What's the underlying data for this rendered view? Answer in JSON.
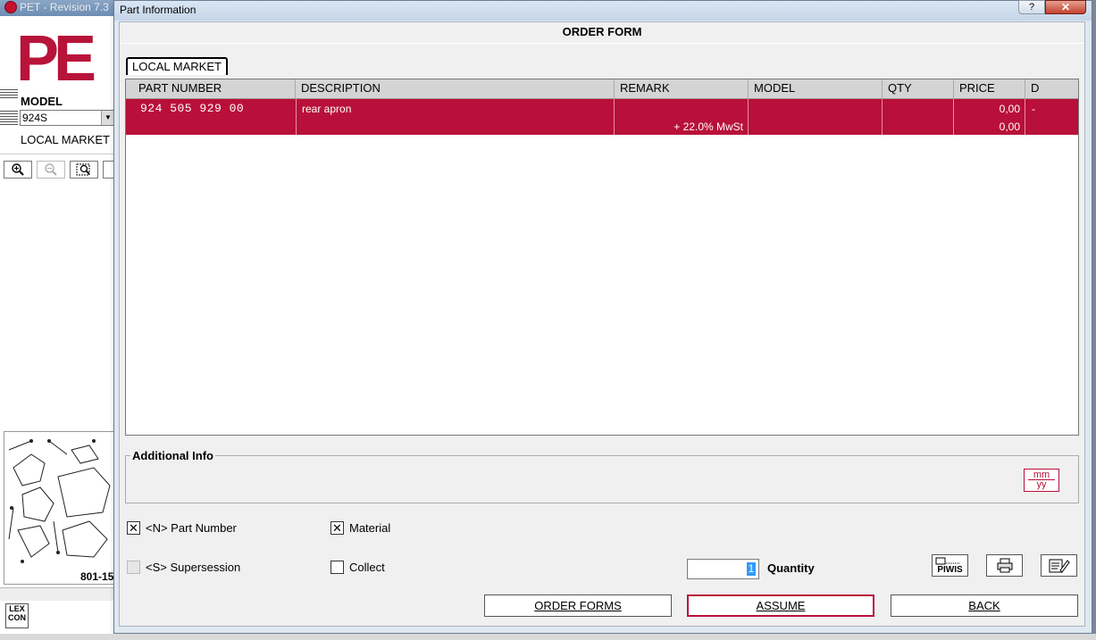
{
  "background_app": {
    "title": "PET - Revision 7.3",
    "logo": "PE",
    "model_label": "MODEL",
    "model_value": "924S",
    "local_market": "LOCAL MARKET",
    "drawing_label": "801-15",
    "lex_icon": "LEX CON"
  },
  "dialog": {
    "title": "Part Information",
    "help_label": "?",
    "close_label": "✕",
    "form_title": "ORDER FORM",
    "tab_label": "LOCAL MARKET",
    "columns": [
      "PART NUMBER",
      "DESCRIPTION",
      "REMARK",
      "MODEL",
      "QTY",
      "PRICE",
      "D"
    ],
    "rows": [
      {
        "part_number": "924 505 929 00",
        "description": "rear apron",
        "remark": "+ 22.0% MwSt",
        "model": "",
        "qty": "",
        "price_1": "0,00",
        "price_2": "0,00",
        "d": "-"
      }
    ],
    "additional_info_label": "Additional Info",
    "mmyy": {
      "top": "mm",
      "bottom": "yy"
    },
    "checkboxes": {
      "part_number": {
        "label": "<N> Part Number",
        "checked": true
      },
      "material": {
        "label": "Material",
        "checked": true
      },
      "supersession": {
        "label": "<S> Supersession",
        "checked": false
      },
      "collect": {
        "label": "Collect",
        "checked": false
      }
    },
    "quantity": {
      "value": "1",
      "label": "Quantity"
    },
    "piwis_label": "PIWIS",
    "buttons": {
      "order_forms": "ORDER FORMS",
      "assume": "ASSUME",
      "back": "BACK"
    }
  },
  "icons": [
    "zoom-in-icon",
    "zoom-out-icon",
    "zoom-window-icon",
    "printer-icon",
    "edit-form-icon",
    "piwis-icon"
  ],
  "colors": {
    "accent": "#b8103a",
    "grid_header": "#d4d4d4",
    "title_bar": "#c5d5e8"
  }
}
